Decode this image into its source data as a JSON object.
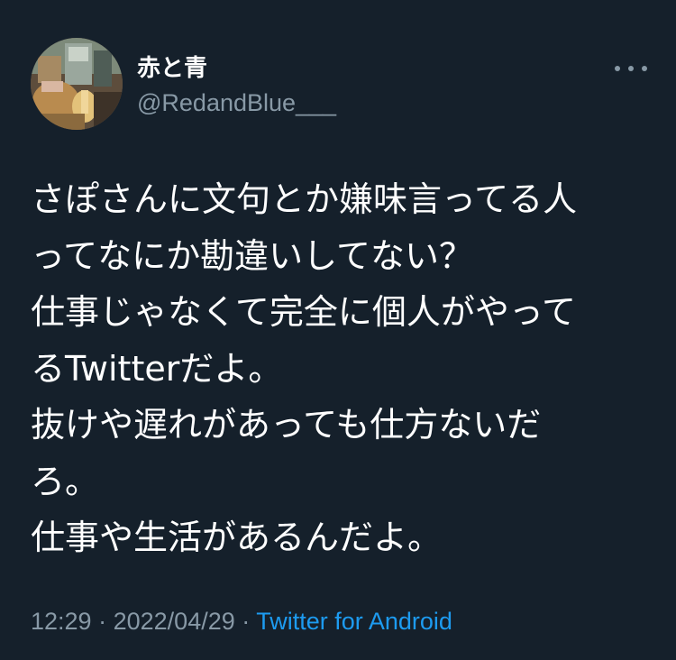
{
  "tweet": {
    "display_name": "赤と青",
    "handle": "@RedandBlue___",
    "body_lines": [
      "さぽさんに文句とか嫌味言ってる人",
      "ってなにか勘違いしてない？",
      "仕事じゃなくて完全に個人がやって",
      "るTwitterだよ。",
      "抜けや遅れがあっても仕方ないだ",
      "ろ。",
      "仕事や生活があるんだよ。"
    ],
    "time": "12:29",
    "separator": "·",
    "date": "2022/04/29",
    "source": "Twitter for Android"
  },
  "icons": {
    "avatar": "avatar-photo",
    "more": "more-horizontal-icon"
  },
  "colors": {
    "background": "#15202b",
    "text": "#ffffff",
    "muted": "#8899a6",
    "link": "#1d9bf0"
  }
}
